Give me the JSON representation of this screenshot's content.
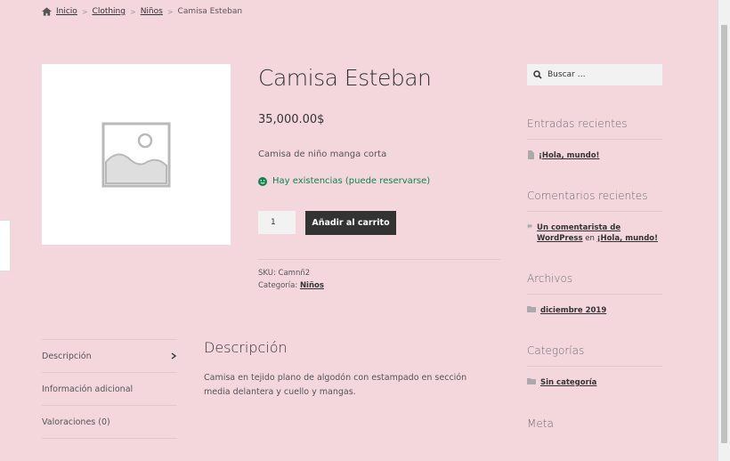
{
  "breadcrumb": {
    "home": "Inicio",
    "cat1": "Clothing",
    "cat2": "Niños",
    "current": "Camisa Esteban",
    "sep": ">"
  },
  "product": {
    "title": "Camisa Esteban",
    "price": "35,000.00$",
    "short_description": "Camisa de niño manga corta",
    "stock": "Hay existencias (puede reservarse)",
    "quantity": "1",
    "add_to_cart": "Añadir al carrito",
    "sku_label": "SKU:",
    "sku": "Camnñ2",
    "category_label": "Categoría:",
    "category": "Niños"
  },
  "tabs": [
    {
      "label": "Descripción"
    },
    {
      "label": "Información adicional"
    },
    {
      "label": "Valoraciones (0)"
    }
  ],
  "description": {
    "title": "Descripción",
    "text": "Camisa en tejido plano de algodón con estampado en sección media delantera y cuello y mangas."
  },
  "sidebar": {
    "search_placeholder": "Buscar …",
    "recent_posts_title": "Entradas recientes",
    "recent_post": "¡Hola, mundo!",
    "recent_comments_title": "Comentarios recientes",
    "comment_author": "Un comentarista de WordPress",
    "comment_on": "en",
    "comment_post": "¡Hola, mundo!",
    "archives_title": "Archivos",
    "archive": "diciembre 2019",
    "categories_title": "Categorías",
    "category": "Sin categoría",
    "meta_title": "Meta"
  },
  "colors": {
    "background": "#f4d7dc",
    "button": "#333333",
    "stock": "#0f834d"
  }
}
